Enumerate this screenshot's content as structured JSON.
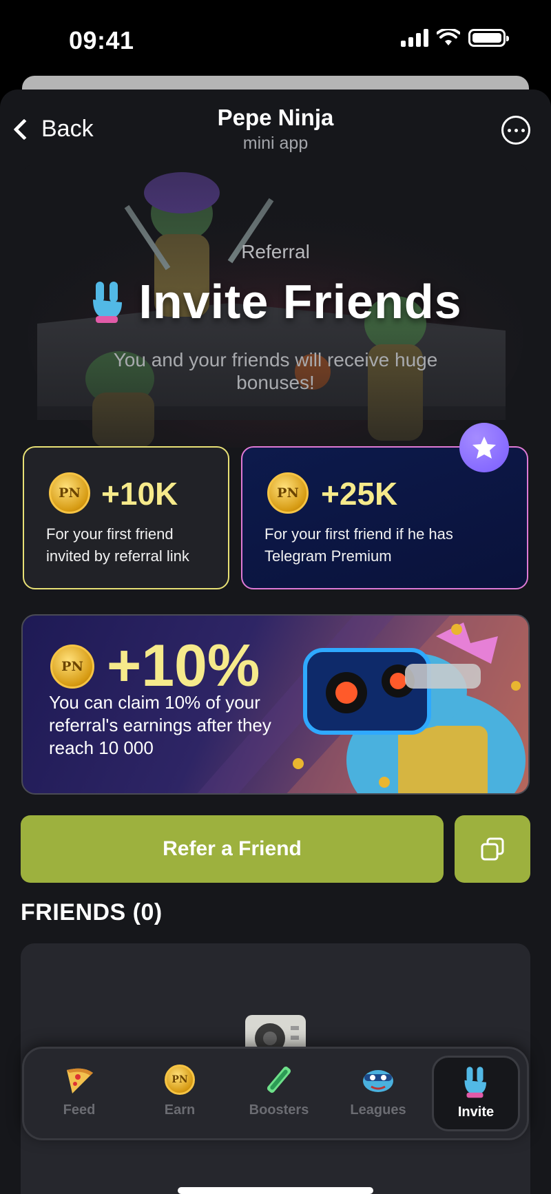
{
  "status_bar": {
    "time": "09:41"
  },
  "header": {
    "back_label": "Back",
    "title": "Pepe Ninja",
    "subtitle": "mini app"
  },
  "hero": {
    "kicker": "Referral",
    "title": "Invite Friends",
    "description": "You and your friends will receive huge bonuses!"
  },
  "rewards": [
    {
      "amount": "+10K",
      "text": "For your first friend invited by referral link",
      "coin": "PN"
    },
    {
      "amount": "+25K",
      "text": "For your first friend if he has Telegram Premium",
      "coin": "PN",
      "badge_icon": "star-icon"
    }
  ],
  "promo": {
    "amount": "+10%",
    "text": "You can claim 10% of your referral's earnings after they reach 10 000",
    "coin": "PN"
  },
  "actions": {
    "refer_label": "Refer a Friend",
    "copy_icon": "copy-icon"
  },
  "friends": {
    "heading": "FRIENDS (0)"
  },
  "tabbar": {
    "tabs": [
      {
        "label": "Feed",
        "icon": "pizza-icon"
      },
      {
        "label": "Earn",
        "icon": "coin-icon"
      },
      {
        "label": "Boosters",
        "icon": "booster-icon"
      },
      {
        "label": "Leagues",
        "icon": "mask-icon"
      },
      {
        "label": "Invite",
        "icon": "hand-sign-icon",
        "active": true
      }
    ]
  },
  "colors": {
    "background": "#16171b",
    "accent_green": "#9db13e",
    "gold_text": "#f6ea8b",
    "card_border_yellow": "#e9e276",
    "card_border_pink": "#e07ad6"
  }
}
